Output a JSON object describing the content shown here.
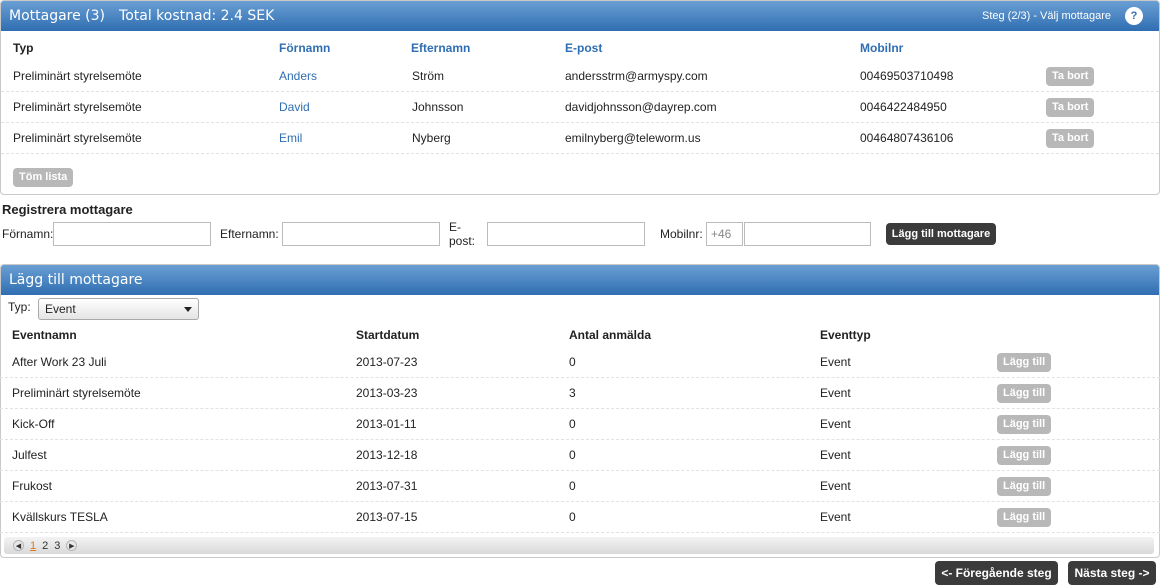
{
  "recipients_panel": {
    "title": "Mottagare (3)",
    "total_cost": "Total kostnad: 2.4 SEK",
    "step": "Steg (2/3) - Välj mottagare",
    "help": "?",
    "columns": {
      "type": "Typ",
      "first": "Förnamn",
      "last": "Efternamn",
      "email": "E-post",
      "mobile": "Mobilnr"
    },
    "rows": [
      {
        "type": "Preliminärt styrelsemöte",
        "first": "Anders",
        "last": "Ström",
        "email": "andersstrm@armyspy.com",
        "mobile": "00469503710498",
        "action": "Ta bort"
      },
      {
        "type": "Preliminärt styrelsemöte",
        "first": "David",
        "last": "Johnsson",
        "email": "davidjohnsson@dayrep.com",
        "mobile": "0046422484950",
        "action": "Ta bort"
      },
      {
        "type": "Preliminärt styrelsemöte",
        "first": "Emil",
        "last": "Nyberg",
        "email": "emilnyberg@teleworm.us",
        "mobile": "00464807436106",
        "action": "Ta bort"
      }
    ],
    "clear_label": "Töm lista"
  },
  "register": {
    "title": "Registrera mottagare",
    "first_label": "Förnamn:",
    "last_label": "Efternamn:",
    "email_label": "E-post:",
    "mobile_label": "Mobilnr:",
    "mobile_prefix": "+46",
    "add_label": "Lägg till mottagare"
  },
  "add_panel": {
    "title": "Lägg till mottagare",
    "type_label": "Typ:",
    "type_value": "Event",
    "columns": {
      "name": "Eventnamn",
      "start": "Startdatum",
      "count": "Antal anmälda",
      "type": "Eventtyp"
    },
    "rows": [
      {
        "name": "After Work 23 Juli",
        "start": "2013-07-23",
        "count": "0",
        "type": "Event",
        "action": "Lägg till"
      },
      {
        "name": "Preliminärt styrelsemöte",
        "start": "2013-03-23",
        "count": "3",
        "type": "Event",
        "action": "Lägg till"
      },
      {
        "name": "Kick-Off",
        "start": "2013-01-11",
        "count": "0",
        "type": "Event",
        "action": "Lägg till"
      },
      {
        "name": "Julfest",
        "start": "2013-12-18",
        "count": "0",
        "type": "Event",
        "action": "Lägg till"
      },
      {
        "name": "Frukost",
        "start": "2013-07-31",
        "count": "0",
        "type": "Event",
        "action": "Lägg till"
      },
      {
        "name": "Kvällskurs TESLA",
        "start": "2013-07-15",
        "count": "0",
        "type": "Event",
        "action": "Lägg till"
      }
    ],
    "pages": [
      "1",
      "2",
      "3"
    ]
  },
  "nav": {
    "prev_label": "<- Föregående steg",
    "next_label": "Nästa steg ->"
  }
}
